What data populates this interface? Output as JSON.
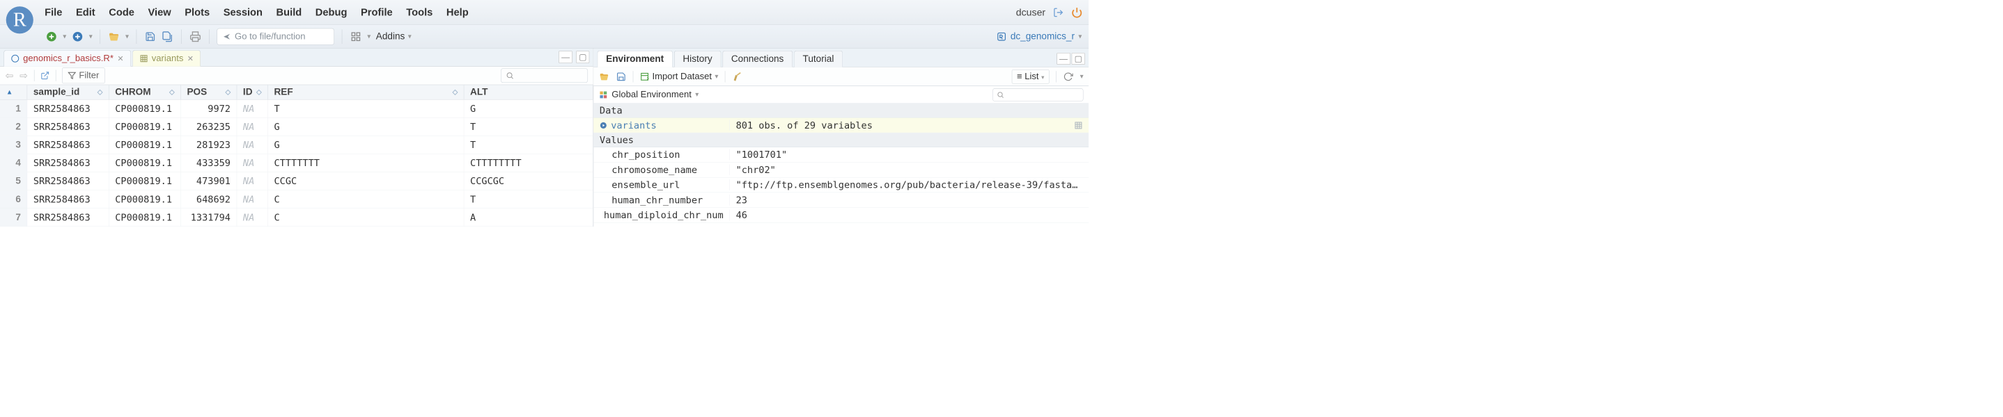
{
  "menu": {
    "items": [
      "File",
      "Edit",
      "Code",
      "View",
      "Plots",
      "Session",
      "Build",
      "Debug",
      "Profile",
      "Tools",
      "Help"
    ],
    "user": "dcuser"
  },
  "toolbar": {
    "goto_placeholder": "Go to file/function",
    "addins_label": "Addins",
    "project_name": "dc_genomics_r"
  },
  "left_tabs": {
    "t0": {
      "label": "genomics_r_basics.R*"
    },
    "t1": {
      "label": "variants"
    }
  },
  "filter": {
    "label": "Filter"
  },
  "table": {
    "headers": {
      "sample_id": "sample_id",
      "chrom": "CHROM",
      "pos": "POS",
      "id": "ID",
      "ref": "REF",
      "alt": "ALT"
    },
    "rows": [
      {
        "n": "1",
        "sample_id": "SRR2584863",
        "chrom": "CP000819.1",
        "pos": "9972",
        "id": "NA",
        "ref": "T",
        "alt": "G"
      },
      {
        "n": "2",
        "sample_id": "SRR2584863",
        "chrom": "CP000819.1",
        "pos": "263235",
        "id": "NA",
        "ref": "G",
        "alt": "T"
      },
      {
        "n": "3",
        "sample_id": "SRR2584863",
        "chrom": "CP000819.1",
        "pos": "281923",
        "id": "NA",
        "ref": "G",
        "alt": "T"
      },
      {
        "n": "4",
        "sample_id": "SRR2584863",
        "chrom": "CP000819.1",
        "pos": "433359",
        "id": "NA",
        "ref": "CTTTTTTT",
        "alt": "CTTTTTTTT"
      },
      {
        "n": "5",
        "sample_id": "SRR2584863",
        "chrom": "CP000819.1",
        "pos": "473901",
        "id": "NA",
        "ref": "CCGC",
        "alt": "CCGCGC"
      },
      {
        "n": "6",
        "sample_id": "SRR2584863",
        "chrom": "CP000819.1",
        "pos": "648692",
        "id": "NA",
        "ref": "C",
        "alt": "T"
      },
      {
        "n": "7",
        "sample_id": "SRR2584863",
        "chrom": "CP000819.1",
        "pos": "1331794",
        "id": "NA",
        "ref": "C",
        "alt": "A"
      }
    ]
  },
  "env_tabs": [
    "Environment",
    "History",
    "Connections",
    "Tutorial"
  ],
  "env_toolbar": {
    "import_label": "Import Dataset",
    "list_label": "List"
  },
  "env_scope": {
    "label": "Global Environment"
  },
  "env": {
    "data_header": "Data",
    "values_header": "Values",
    "data": [
      {
        "name": "variants",
        "value": "801 obs. of 29 variables"
      }
    ],
    "values": [
      {
        "name": "chr_position",
        "value": "\"1001701\""
      },
      {
        "name": "chromosome_name",
        "value": "\"chr02\""
      },
      {
        "name": "ensemble_url",
        "value": "\"ftp://ftp.ensemblgenomes.org/pub/bacteria/release-39/fasta…"
      },
      {
        "name": "human_chr_number",
        "value": "23"
      },
      {
        "name": "human_diploid_chr_num",
        "value": "46"
      }
    ]
  }
}
